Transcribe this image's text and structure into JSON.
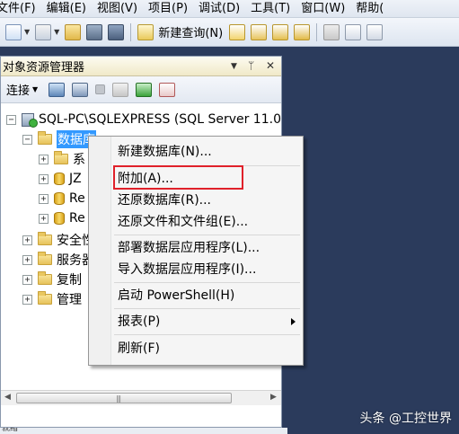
{
  "menubar": {
    "items": [
      "文件(F)",
      "编辑(E)",
      "视图(V)",
      "项目(P)",
      "调试(D)",
      "工具(T)",
      "窗口(W)",
      "帮助("
    ]
  },
  "toolbar": {
    "new_query_label": "新建查询(N)"
  },
  "object_explorer": {
    "title": "对象资源管理器",
    "connect_label": "连接",
    "tree": {
      "server": "SQL-PC\\SQLEXPRESS (SQL Server 11.0",
      "databases": "数据库",
      "children": [
        "系",
        "JZ",
        "Re",
        "Re"
      ],
      "security": "安全性",
      "server_objects": "服务器",
      "replication": "复制",
      "management": "管理"
    }
  },
  "context_menu": {
    "items": {
      "new_db": "新建数据库(N)...",
      "attach": "附加(A)...",
      "restore_db": "还原数据库(R)...",
      "restore_files": "还原文件和文件组(E)...",
      "deploy_dac": "部署数据层应用程序(L)...",
      "import_dac": "导入数据层应用程序(I)...",
      "powershell": "启动 PowerShell(H)",
      "reports": "报表(P)",
      "refresh": "刷新(F)"
    }
  },
  "status": {
    "text": "就绪"
  },
  "watermark": {
    "text": "头条 @工控世界"
  }
}
